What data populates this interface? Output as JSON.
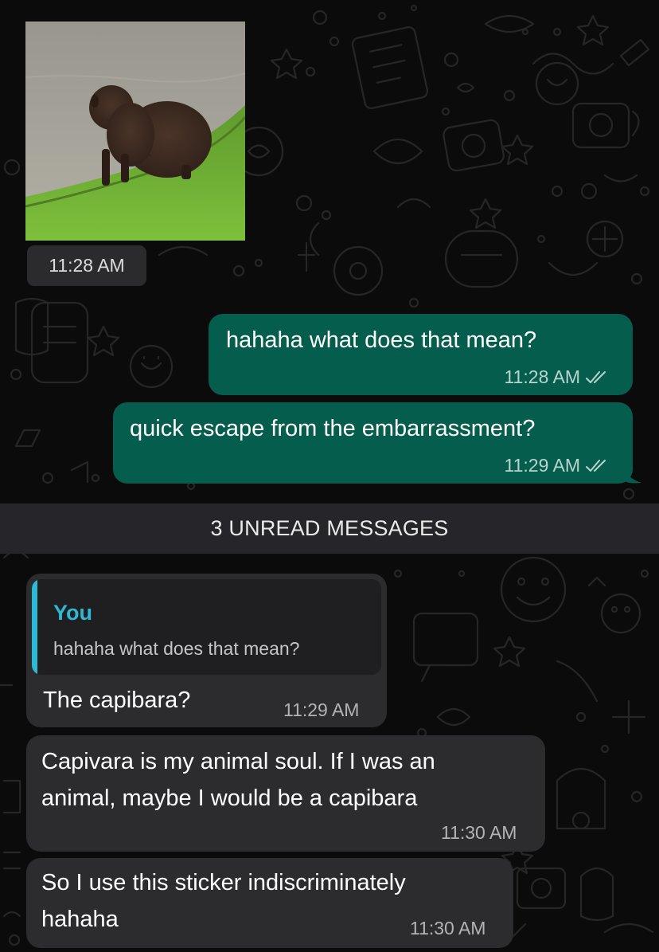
{
  "chat": {
    "sticker": {
      "time": "11:28 AM"
    },
    "outgoing": [
      {
        "text": "hahaha what does that mean?",
        "time": "11:28 AM",
        "status_icon": "double-check-icon"
      },
      {
        "text": "quick escape from the embarrassment?",
        "time": "11:29 AM",
        "status_icon": "double-check-icon"
      }
    ],
    "unread_divider": "3 UNREAD MESSAGES",
    "incoming": [
      {
        "reply_to": {
          "author": "You",
          "text": "hahaha what does that mean?"
        },
        "text": "The capibara?",
        "time": "11:29 AM"
      },
      {
        "text": "Capivara is my animal soul. If I was an animal, maybe I would be a capibara",
        "time": "11:30 AM"
      },
      {
        "text": "So I use this sticker indiscriminately hahaha",
        "time": "11:30 AM"
      }
    ]
  },
  "colors": {
    "background": "#0b0b0b",
    "outgoing_bubble": "#055e4d",
    "incoming_bubble": "#2c2c2f",
    "quote_accent": "#2fb8d3",
    "divider_bar": "#26262a"
  }
}
